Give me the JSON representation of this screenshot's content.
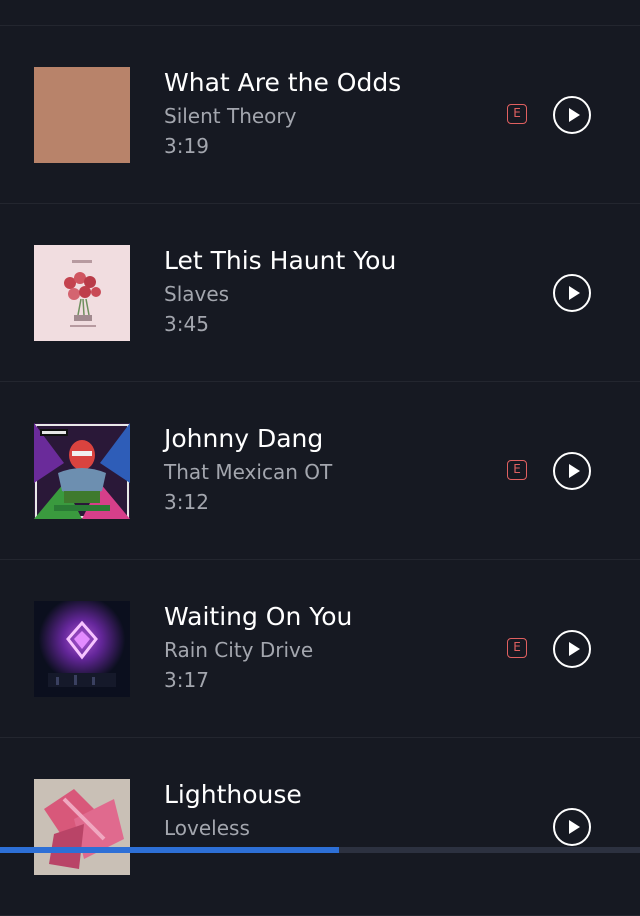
{
  "tracks": [
    {
      "title": "What Are the Odds",
      "artist": "Silent Theory",
      "duration": "3:19",
      "explicit": true,
      "explicit_label": "E",
      "cover": "solid-cover"
    },
    {
      "title": "Let This Haunt You",
      "artist": "Slaves",
      "duration": "3:45",
      "explicit": false,
      "explicit_label": "",
      "cover": "roses-cover"
    },
    {
      "title": "Johnny Dang",
      "artist": "That Mexican OT",
      "duration": "3:12",
      "explicit": true,
      "explicit_label": "E",
      "cover": "wrestler-cover"
    },
    {
      "title": "Waiting On You",
      "artist": "Rain City Drive",
      "duration": "3:17",
      "explicit": true,
      "explicit_label": "E",
      "cover": "neon-cover"
    },
    {
      "title": "Lighthouse",
      "artist": "Loveless",
      "duration": "",
      "explicit": false,
      "explicit_label": "",
      "cover": "pink-cover"
    }
  ],
  "colors": {
    "background": "#161922",
    "explicit": "#e06060",
    "secondary_text": "#a3a6ae",
    "progress": "#2d6fd6"
  },
  "progress": 0.53
}
